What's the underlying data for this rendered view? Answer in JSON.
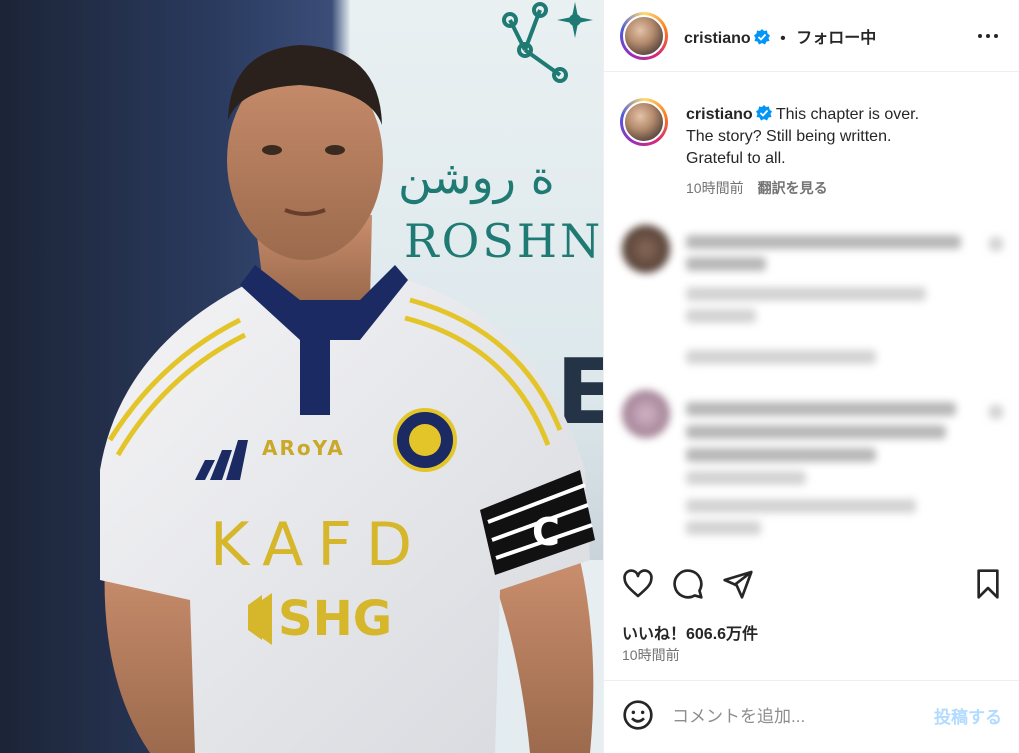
{
  "header": {
    "username": "cristiano",
    "separator": "•",
    "follow_status": "フォロー中",
    "more_icon": "more-horizontal-icon"
  },
  "caption": {
    "username": "cristiano",
    "lines": [
      "This chapter is over.",
      "The story? Still being written.",
      "Grateful to all."
    ],
    "time": "10時間前",
    "translate": "翻訳を見る"
  },
  "photo": {
    "banner_arabic": "ة روشن",
    "banner_english": "ROSHN C",
    "banner_letter": "E",
    "jersey_sponsor_top": "ARoYA",
    "jersey_main": "KAFD",
    "jersey_shg": "SHG",
    "armband": "C"
  },
  "actions": {
    "like_icon": "heart-icon",
    "comment_icon": "comment-icon",
    "share_icon": "send-icon",
    "save_icon": "bookmark-icon"
  },
  "stats": {
    "likes": "いいね！606.6万件",
    "time": "10時間前"
  },
  "add_comment": {
    "placeholder": "コメントを追加...",
    "post_label": "投稿する"
  },
  "colors": {
    "verified": "#0095f6",
    "post_disabled": "#b3dbff",
    "banner_teal": "#1f7a74",
    "jersey_gold": "#e3c52a",
    "jersey_navy": "#1b2a63"
  }
}
